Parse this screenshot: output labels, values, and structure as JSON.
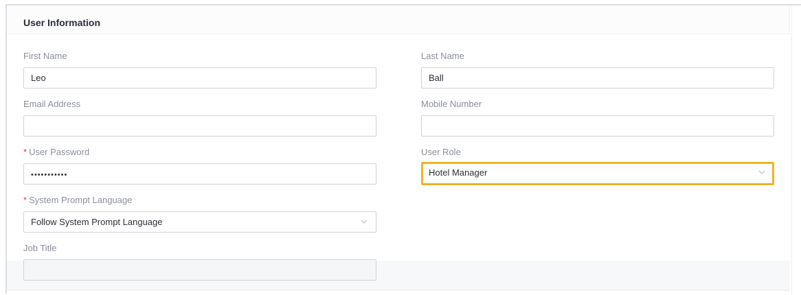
{
  "panel": {
    "title": "User Information"
  },
  "fields": {
    "first_name": {
      "label": "First Name",
      "value": "Leo"
    },
    "last_name": {
      "label": "Last Name",
      "value": "Ball"
    },
    "email": {
      "label": "Email Address",
      "value": ""
    },
    "mobile": {
      "label": "Mobile Number",
      "value": ""
    },
    "password": {
      "label": "User Password",
      "required_mark": "*",
      "value": "•••••••••••"
    },
    "role": {
      "label": "User Role",
      "value": "Hotel Manager"
    },
    "language": {
      "label": "System Prompt Language",
      "required_mark": "*",
      "value": "Follow System Prompt Language"
    },
    "job_title": {
      "label": "Job Title",
      "value": ""
    }
  },
  "colors": {
    "highlight": "#f0b323",
    "required": "#e4393c"
  }
}
